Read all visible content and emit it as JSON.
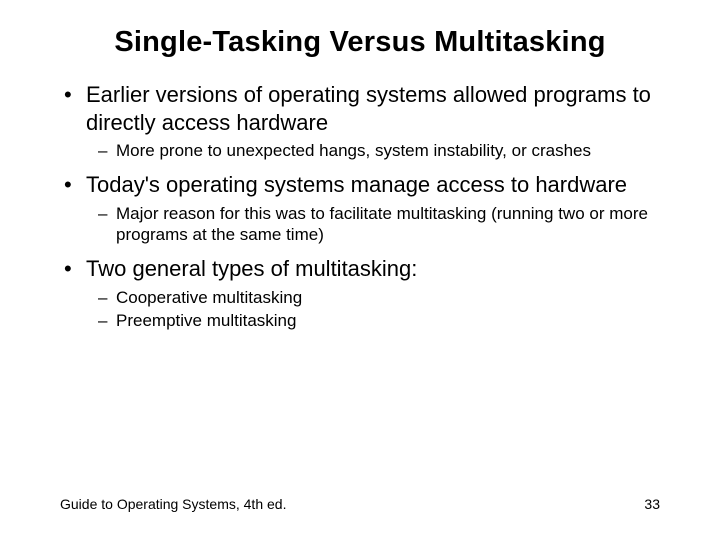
{
  "title": "Single-Tasking Versus Multitasking",
  "bullets": {
    "b1": "Earlier versions of operating systems allowed programs to directly access hardware",
    "b1s1": "More prone to unexpected hangs, system instability, or crashes",
    "b2": "Today's operating systems manage access to hardware",
    "b2s1": "Major reason for this was to facilitate multitasking (running two or more programs at the same time)",
    "b3": "Two general types of multitasking:",
    "b3s1": "Cooperative multitasking",
    "b3s2": "Preemptive multitasking"
  },
  "footer": {
    "source": "Guide to Operating Systems, 4th ed.",
    "page": "33"
  }
}
